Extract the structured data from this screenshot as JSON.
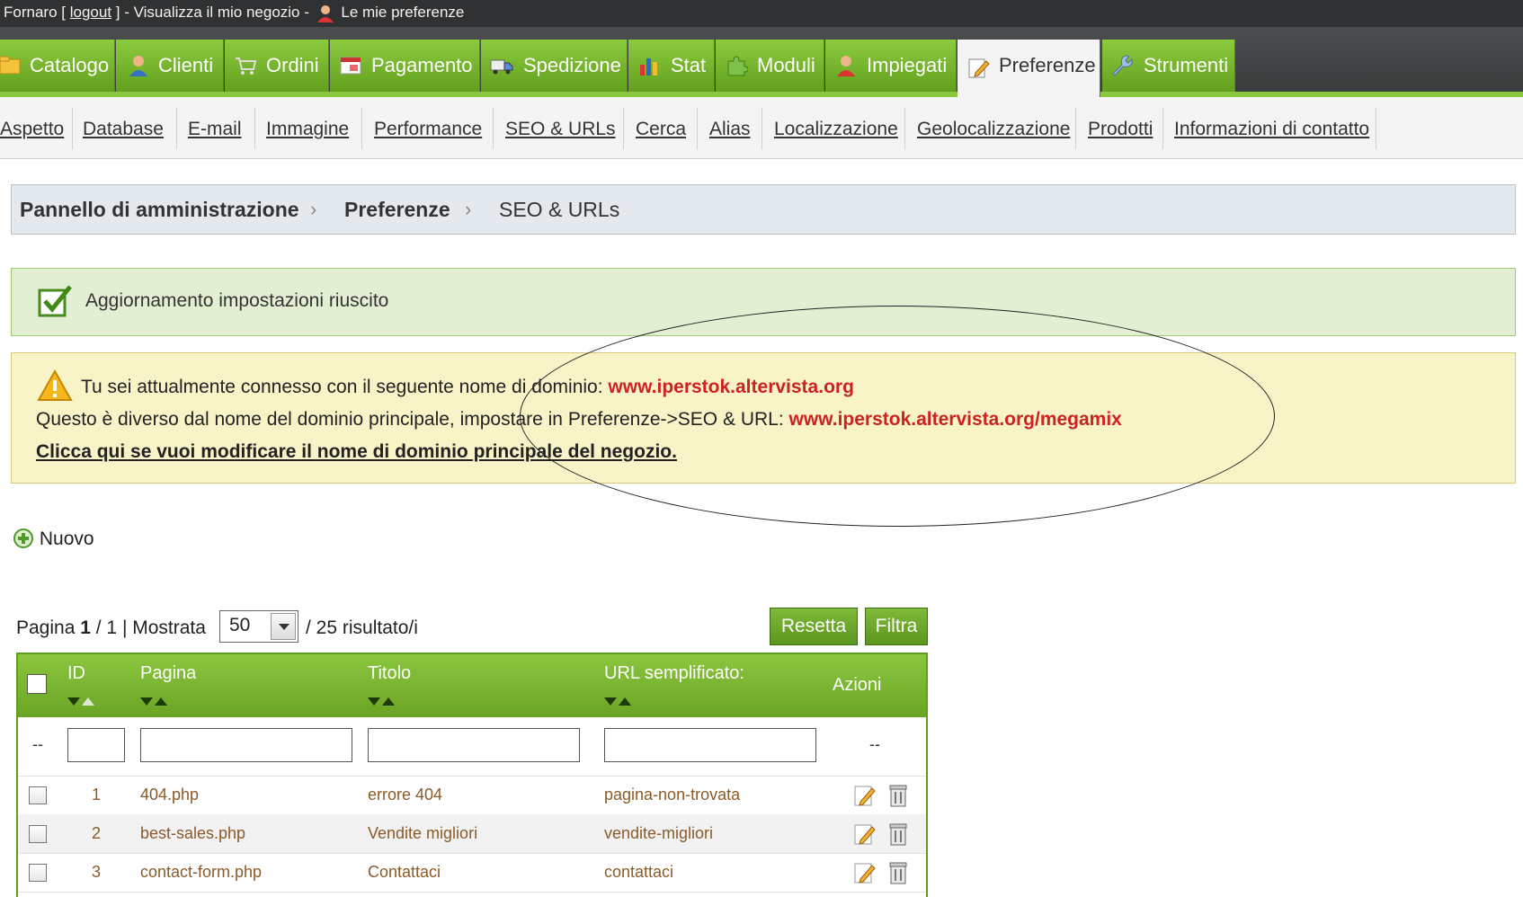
{
  "topbar": {
    "user": "Fornaro [",
    "logout": "logout",
    "after_logout": "] - Visualizza il mio negozio -",
    "prefs": "Le mie preferenze"
  },
  "tabs": [
    {
      "label": "Catalogo",
      "icon": "folder-icon"
    },
    {
      "label": "Clienti",
      "icon": "user-icon"
    },
    {
      "label": "Ordini",
      "icon": "cart-icon"
    },
    {
      "label": "Pagamento",
      "icon": "payment-icon"
    },
    {
      "label": "Spedizione",
      "icon": "truck-icon"
    },
    {
      "label": "Stat",
      "icon": "bar-chart-icon"
    },
    {
      "label": "Moduli",
      "icon": "puzzle-icon"
    },
    {
      "label": "Impiegati",
      "icon": "employee-icon"
    },
    {
      "label": "Preferenze",
      "icon": "edit-icon",
      "active": true
    },
    {
      "label": "Strumenti",
      "icon": "wrench-icon"
    }
  ],
  "subtabs": [
    "Aspetto",
    "Database",
    "E-mail",
    "Immagine",
    "Performance",
    "SEO & URLs",
    "Cerca",
    "Alias",
    "Localizzazione",
    "Geolocalizzazione",
    "Prodotti",
    "Informazioni di contatto"
  ],
  "breadcrumb": {
    "first": "Pannello di amministrazione",
    "second": "Preferenze",
    "current": "SEO & URLs",
    "separator": "›"
  },
  "success": {
    "message": "Aggiornamento impostazioni riuscito"
  },
  "warning": {
    "line1_text": "Tu sei attualmente connesso con il seguente nome di dominio:",
    "line1_domain": "www.iperstok.altervista.org",
    "line2_text": "Questo è diverso dal nome del dominio principale, impostare in Preferenze->SEO & URL:",
    "line2_domain": "www.iperstok.altervista.org/megamix",
    "link": "Clicca qui se vuoi modificare il nome di dominio principale del negozio."
  },
  "new_button": "Nuovo",
  "pagination": {
    "prefix": "Pagina",
    "page": "1",
    "total_part": "/ 1 | Mostrata",
    "per_page": "50",
    "results": "/ 25 risultato/i"
  },
  "buttons": {
    "reset": "Resetta",
    "filter": "Filtra"
  },
  "table": {
    "headers": {
      "id": "ID",
      "page": "Pagina",
      "title": "Titolo",
      "url": "URL semplificato:",
      "actions": "Azioni"
    },
    "filter_dash": "--",
    "rows": [
      {
        "id": "1",
        "page": "404.php",
        "title": "errore 404",
        "url": "pagina-non-trovata"
      },
      {
        "id": "2",
        "page": "best-sales.php",
        "title": "Vendite migliori",
        "url": "vendite-migliori"
      },
      {
        "id": "3",
        "page": "contact-form.php",
        "title": "Contattaci",
        "url": "contattaci"
      }
    ]
  },
  "colors": {
    "green": "#8cc63f",
    "red_domain": "#cc2222",
    "warning_bg": "#f8f4c8",
    "success_bg": "#e3efd2"
  }
}
